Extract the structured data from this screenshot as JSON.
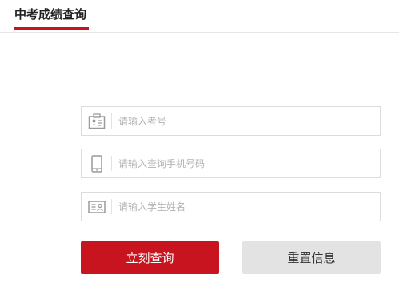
{
  "header": {
    "title": "中考成绩查询"
  },
  "form": {
    "exam_number": {
      "placeholder": "请输入考号",
      "icon": "id-card-icon"
    },
    "phone": {
      "placeholder": "请输入查询手机号码",
      "icon": "mobile-phone-icon"
    },
    "student_name": {
      "placeholder": "请输入学生姓名",
      "icon": "name-card-icon"
    }
  },
  "buttons": {
    "query_label": "立刻查询",
    "reset_label": "重置信息"
  },
  "colors": {
    "accent": "#c8141e",
    "secondary_button": "#e3e3e3",
    "border": "#dcdcdc",
    "placeholder": "#b3b3b3"
  }
}
